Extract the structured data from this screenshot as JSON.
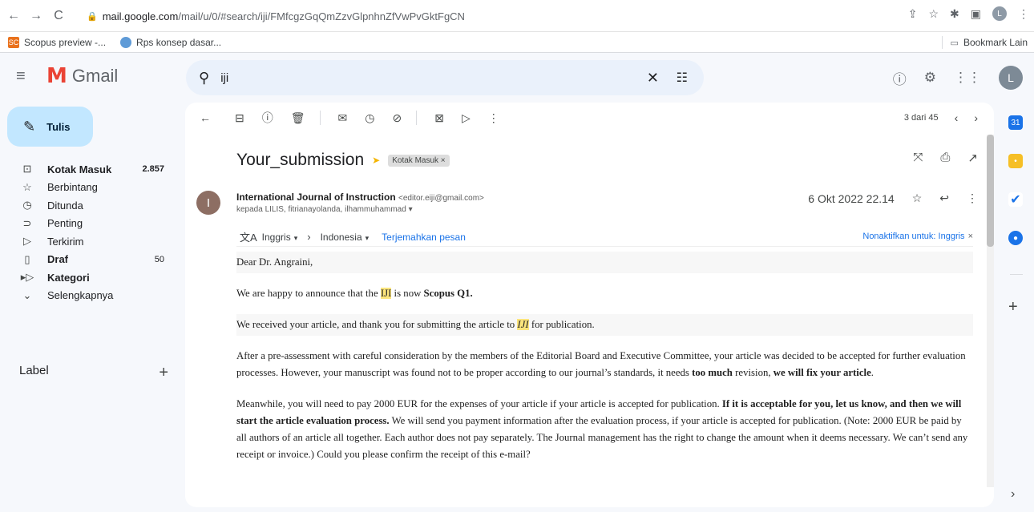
{
  "browser": {
    "url_host": "mail.google.com",
    "url_path": "/mail/u/0/#search/iji/FMfcgzGqQmZzvGlpnhnZfVwPvGktFgCN",
    "profile_initial": "L",
    "bookmarks": [
      {
        "label": "Scopus preview -...",
        "icon": "scopus-icon",
        "icon_text": "SC",
        "color": "#e9711c"
      },
      {
        "label": "Rps konsep dasar...",
        "icon": "rps-icon",
        "icon_text": "",
        "color": "#5f9bd7"
      }
    ],
    "bookmark_other": "Bookmark Lain"
  },
  "header": {
    "app_name": "Gmail",
    "search_value": "iji",
    "avatar_initial": "L"
  },
  "sidebar": {
    "compose_label": "Tulis",
    "items": [
      {
        "label": "Kotak Masuk",
        "count": "2.857",
        "icon": "inbox-icon",
        "bold": true
      },
      {
        "label": "Berbintang",
        "count": "",
        "icon": "star-icon",
        "bold": false
      },
      {
        "label": "Ditunda",
        "count": "",
        "icon": "clock-icon",
        "bold": false
      },
      {
        "label": "Penting",
        "count": "",
        "icon": "important-icon",
        "bold": false
      },
      {
        "label": "Terkirim",
        "count": "",
        "icon": "send-icon",
        "bold": false
      },
      {
        "label": "Draf",
        "count": "50",
        "icon": "draft-icon",
        "bold": true
      },
      {
        "label": "Kategori",
        "count": "",
        "icon": "label-icon",
        "bold": true
      },
      {
        "label": "Selengkapnya",
        "count": "",
        "icon": "chevron-down-icon",
        "bold": false
      }
    ],
    "label_heading": "Label"
  },
  "toolbar": {
    "pager_text": "3 dari 45"
  },
  "email": {
    "subject": "Your_submission",
    "label_chip": "Kotak Masuk ×",
    "sender_name": "International Journal of Instruction",
    "sender_email": "<editor.eiji@gmail.com>",
    "recipients": "kepada LILIS, fitrianayolanda, ilhammuhammad",
    "date": "6 Okt 2022 22.14",
    "translate": {
      "from_lang": "Inggris",
      "to_lang": "Indonesia",
      "translate_link": "Terjemahkan pesan",
      "disable_link": "Nonaktifkan untuk: Inggris"
    },
    "body": {
      "greeting": "Dear Dr. Angraini,",
      "p1_a": "We are happy to announce that the ",
      "p1_hl": "IJI",
      "p1_b": " is now ",
      "p1_bold": "Scopus Q1.",
      "p2_a": "We received your article, and thank you for submitting the article to ",
      "p2_hl": "IJI",
      "p2_b": " for publication.",
      "p3_a": "After a pre-assessment with careful consideration by the members of the Editorial Board and Executive Committee, your article was decided to be accepted for further evaluation processes. However, your manuscript was found not to be proper according to our journal’s standards, it needs ",
      "p3_bold1": "too much",
      "p3_b": " revision, ",
      "p3_bold2": "we will fix your article",
      "p3_c": ".",
      "p4_a": "Meanwhile, you will need to pay 2000 EUR for the expenses of your article if your article is accepted for publication. ",
      "p4_bold": "If it is acceptable for you, let us know, and then we will start the article evaluation process.",
      "p4_b": " We will send you payment information after the evaluation process, if your article is accepted for publication. (Note: 2000 EUR be paid by all authors of an article all together. Each author does not pay separately. The Journal management has the right to change the amount when it deems necessary. We can’t send any receipt or invoice.) Could you please confirm the receipt of this e-mail?"
    }
  },
  "colors": {
    "compose": "#c2e7ff",
    "search_bg": "#eaf1fb",
    "highlight": "#fce57c",
    "link": "#1a73e8"
  }
}
